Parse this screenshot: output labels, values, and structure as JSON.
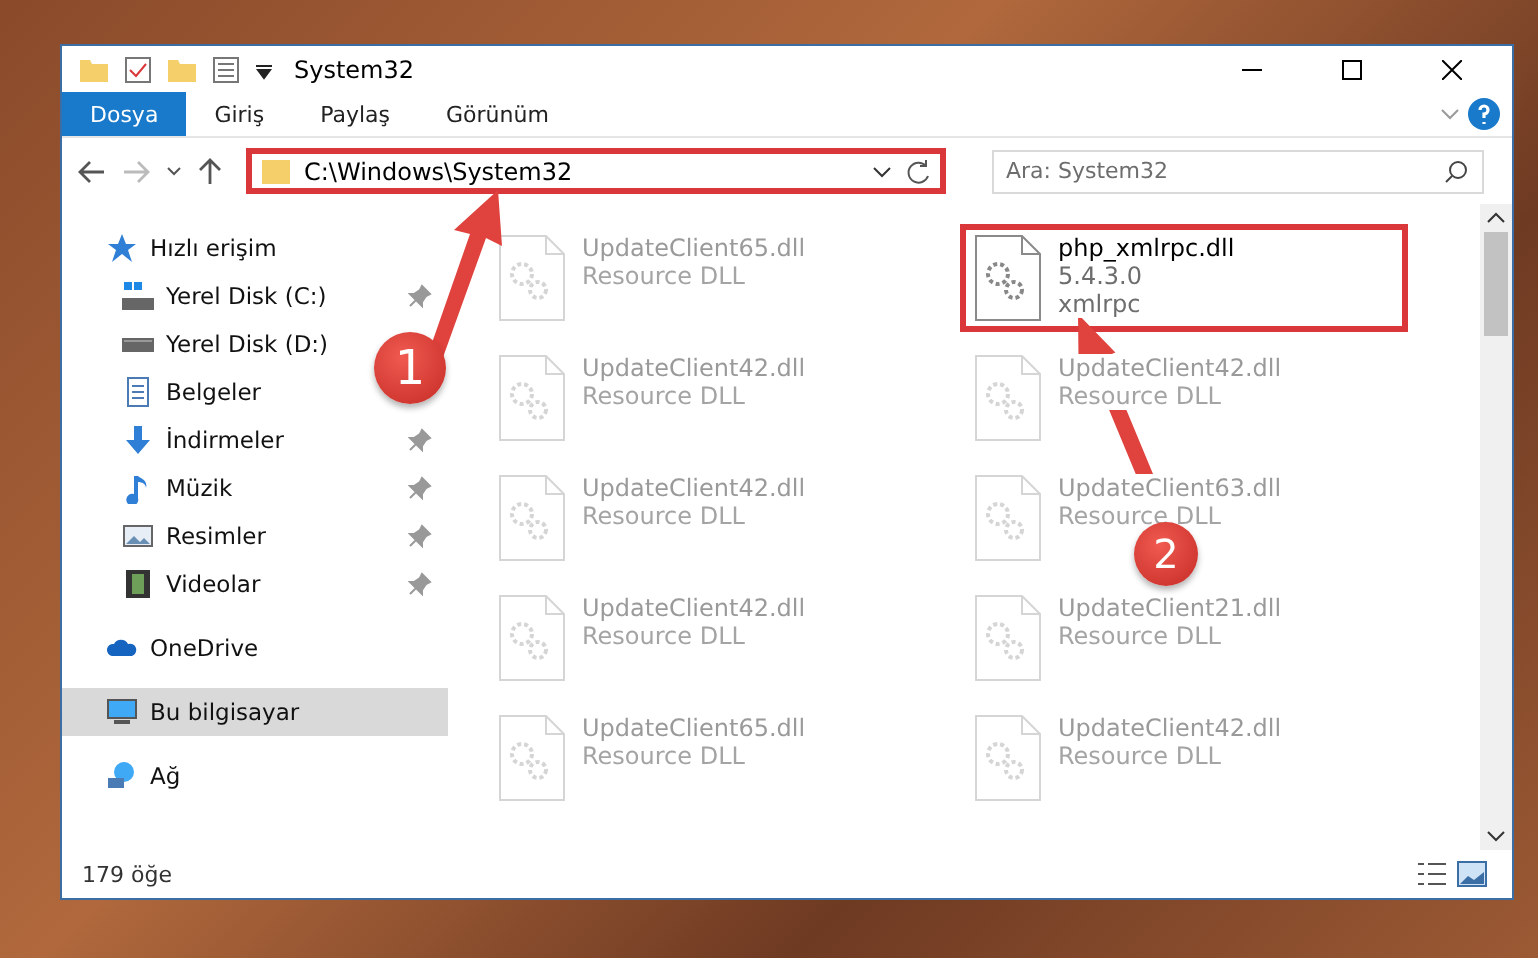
{
  "window": {
    "title": "System32"
  },
  "ribbon_tabs": [
    {
      "label": "Dosya",
      "selected": true
    },
    {
      "label": "Giriş",
      "selected": false
    },
    {
      "label": "Paylaş",
      "selected": false
    },
    {
      "label": "Görünüm",
      "selected": false
    }
  ],
  "address_bar": {
    "path": "C:\\Windows\\System32",
    "highlighted": true
  },
  "search": {
    "placeholder": "Ara: System32"
  },
  "sidebar": {
    "items": [
      {
        "label": "Hızlı erişim",
        "selected": false,
        "children": [
          {
            "label": "Yerel Disk (C:)",
            "pinned": true
          },
          {
            "label": "Yerel Disk (D:)",
            "pinned": false
          },
          {
            "label": "Belgeler",
            "pinned": false
          },
          {
            "label": "İndirmeler",
            "pinned": true
          },
          {
            "label": "Müzik",
            "pinned": true
          },
          {
            "label": "Resimler",
            "pinned": true
          },
          {
            "label": "Videolar",
            "pinned": true
          }
        ]
      },
      {
        "label": "OneDrive",
        "selected": false
      },
      {
        "label": "Bu bilgisayar",
        "selected": true
      },
      {
        "label": "Ağ",
        "selected": false
      }
    ]
  },
  "files": [
    {
      "name": "UpdateClient65.dll",
      "details": [
        "Resource DLL"
      ],
      "faded": true,
      "highlighted": false
    },
    {
      "name": "php_xmlrpc.dll",
      "details": [
        "5.4.3.0",
        "xmlrpc"
      ],
      "faded": false,
      "highlighted": true
    },
    {
      "name": "UpdateClient42.dll",
      "details": [
        "Resource DLL"
      ],
      "faded": true,
      "highlighted": false
    },
    {
      "name": "UpdateClient42.dll",
      "details": [
        "Resource DLL"
      ],
      "faded": true,
      "highlighted": false
    },
    {
      "name": "UpdateClient42.dll",
      "details": [
        "Resource DLL"
      ],
      "faded": true,
      "highlighted": false
    },
    {
      "name": "UpdateClient63.dll",
      "details": [
        "Resource DLL"
      ],
      "faded": true,
      "highlighted": false
    },
    {
      "name": "UpdateClient42.dll",
      "details": [
        "Resource DLL"
      ],
      "faded": true,
      "highlighted": false
    },
    {
      "name": "UpdateClient21.dll",
      "details": [
        "Resource DLL"
      ],
      "faded": true,
      "highlighted": false
    },
    {
      "name": "UpdateClient65.dll",
      "details": [
        "Resource DLL"
      ],
      "faded": true,
      "highlighted": false
    },
    {
      "name": "UpdateClient42.dll",
      "details": [
        "Resource DLL"
      ],
      "faded": true,
      "highlighted": false
    }
  ],
  "status_bar": {
    "count": "179 öğe"
  },
  "annotations": [
    {
      "label": "1"
    },
    {
      "label": "2"
    }
  ]
}
